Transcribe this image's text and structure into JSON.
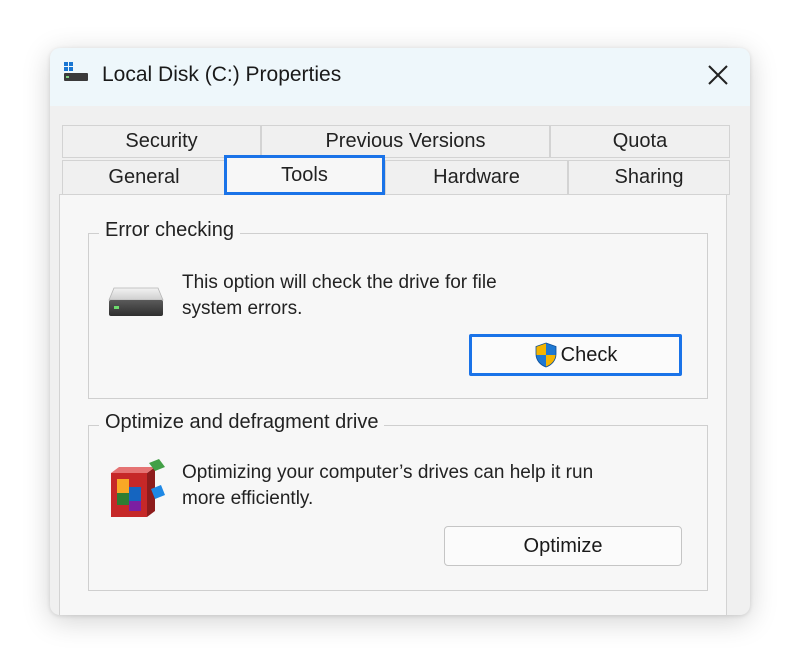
{
  "window": {
    "title": "Local Disk (C:) Properties"
  },
  "tabs": {
    "row_top": [
      "Security",
      "Previous Versions",
      "Quota"
    ],
    "row_bottom": [
      "General",
      "Tools",
      "Hardware",
      "Sharing"
    ],
    "selected": "Tools"
  },
  "error_checking": {
    "label": "Error checking",
    "description_line1": "This option will check the drive for file",
    "description_line2": "system errors.",
    "button_label": "Check",
    "drive_icon": "hard-drive-icon",
    "button_icon": "uac-shield-icon"
  },
  "optimize": {
    "label": "Optimize and defragment drive",
    "description_line1": "Optimizing your computer’s drives can help it run",
    "description_line2": "more efficiently.",
    "button_label": "Optimize",
    "icon": "defragment-blocks-icon"
  },
  "colors": {
    "accent": "#1a73e8",
    "titlebar": "#eef7fb",
    "window_bg": "#f0f0f0"
  }
}
